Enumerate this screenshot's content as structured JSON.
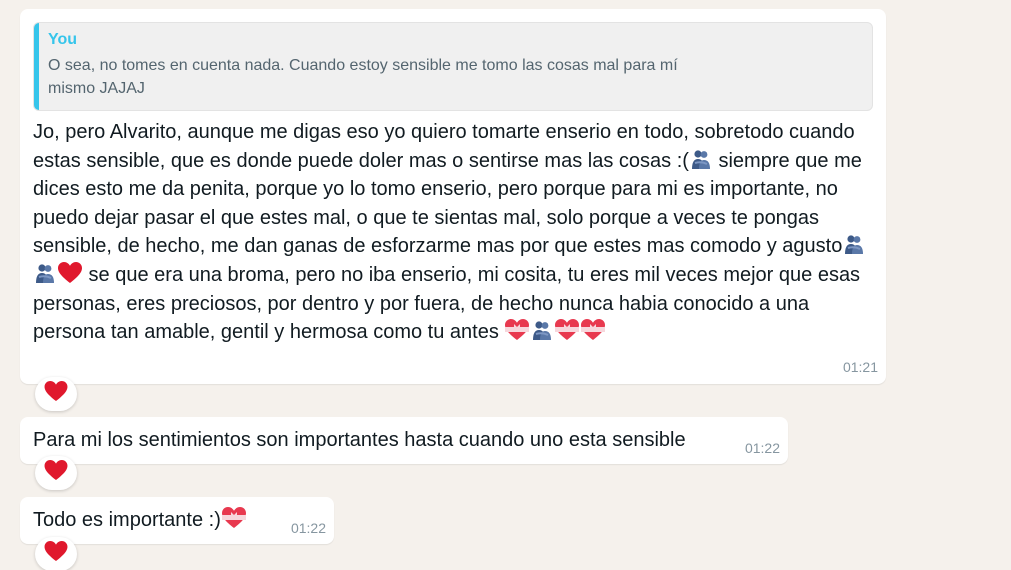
{
  "messages": [
    {
      "quote": {
        "author": "You",
        "text": "O sea, no tomes en cuenta nada. Cuando estoy sensible me tomo las cosas mal para mí mismo JAJAJ"
      },
      "text": {
        "p1": "Jo, pero Alvarito, aunque me digas eso yo quiero tomarte enserio en todo, sobretodo cuando estas sensible, que es donde puede doler mas o sentirse mas las cosas :(",
        "p2": " siempre que me dices esto me da penita, porque yo lo tomo enserio, pero porque para mi es importante, no puedo dejar pasar el que estes mal, o que te sientas mal, solo porque a veces te pongas sensible, de hecho, me dan ganas de esforzarme mas por que estes mas comodo y agusto",
        "p3": " se que era una broma, pero no iba enserio, mi cosita, tu eres mil veces mejor que esas personas, eres preciosos, por dentro y por fuera, de hecho nunca habia conocido a una persona tan amable, gentil y hermosa como tu antes "
      },
      "time": "01:21",
      "reaction": "red-heart"
    },
    {
      "text": "Para mi los sentimientos son importantes hasta cuando uno esta sensible",
      "time": "01:22",
      "reaction": "red-heart"
    },
    {
      "text": "Todo es importante :)",
      "time": "01:22",
      "reaction": "red-heart"
    }
  ],
  "emoji_icons": [
    "people-hugging-icon",
    "red-heart-icon",
    "heart-with-ribbon-icon"
  ],
  "colors": {
    "background": "#f5f1ec",
    "bubble": "#ffffff",
    "quote_accent": "#35c5eb",
    "timestamp": "#8696a0",
    "heart": "#e0182d"
  }
}
